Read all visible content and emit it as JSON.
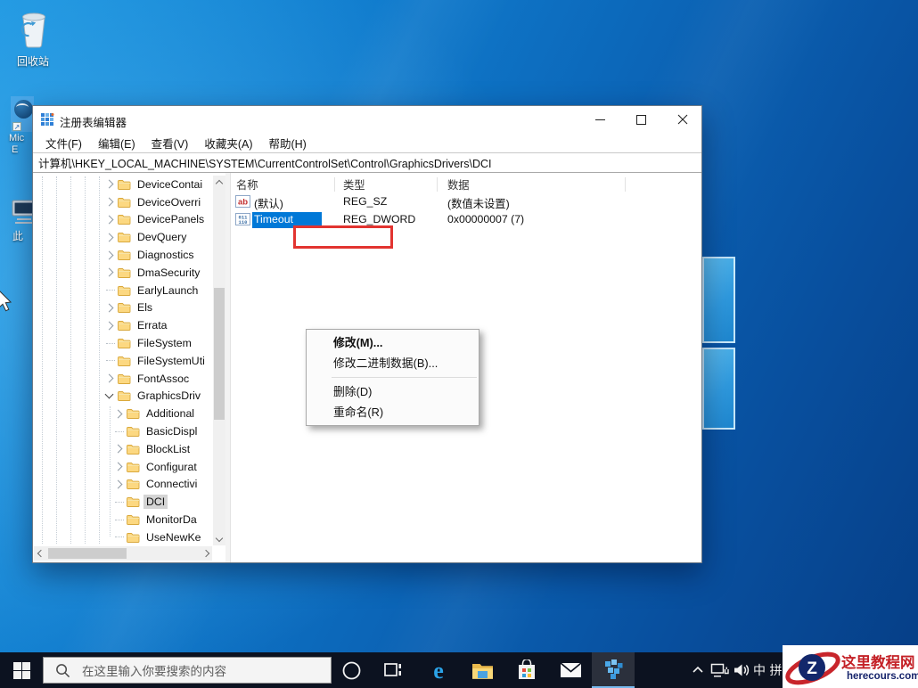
{
  "colors": {
    "accent": "#0078d7",
    "selection_blue": "#0078d7",
    "tree_selection_gray": "#d4d4d4",
    "annotation_red": "#e23430",
    "taskbar_bg": "#0c1220",
    "wallpaper_base": "#0b62b4",
    "watermark_red": "#c42127",
    "watermark_navy": "#16246b",
    "folder_yellow": "#fcd881"
  },
  "desktop": {
    "icons": [
      {
        "key": "recycle-bin",
        "label": "回收站"
      },
      {
        "key": "microsoft-edge",
        "label_line1": "Mic",
        "label_line2": "E"
      },
      {
        "key": "this-pc",
        "label": "此"
      }
    ]
  },
  "window": {
    "title": "注册表编辑器",
    "controls": {
      "minimize": "minimize",
      "maximize": "maximize",
      "close": "close"
    },
    "menu_items": [
      {
        "key": "file",
        "label": "文件(F)"
      },
      {
        "key": "edit",
        "label": "编辑(E)"
      },
      {
        "key": "view",
        "label": "查看(V)"
      },
      {
        "key": "favorites",
        "label": "收藏夹(A)"
      },
      {
        "key": "help",
        "label": "帮助(H)"
      }
    ],
    "address": "计算机\\HKEY_LOCAL_MACHINE\\SYSTEM\\CurrentControlSet\\Control\\GraphicsDrivers\\DCI",
    "tree": {
      "items": [
        {
          "label": "DeviceContai",
          "level": 0,
          "expand": "collapsed",
          "selected": false
        },
        {
          "label": "DeviceOverri",
          "level": 0,
          "expand": "collapsed",
          "selected": false
        },
        {
          "label": "DevicePanels",
          "level": 0,
          "expand": "collapsed",
          "selected": false
        },
        {
          "label": "DevQuery",
          "level": 0,
          "expand": "collapsed",
          "selected": false
        },
        {
          "label": "Diagnostics",
          "level": 0,
          "expand": "collapsed",
          "selected": false
        },
        {
          "label": "DmaSecurity",
          "level": 0,
          "expand": "collapsed",
          "selected": false
        },
        {
          "label": "EarlyLaunch",
          "level": 0,
          "expand": "none",
          "selected": false
        },
        {
          "label": "Els",
          "level": 0,
          "expand": "collapsed",
          "selected": false
        },
        {
          "label": "Errata",
          "level": 0,
          "expand": "collapsed",
          "selected": false
        },
        {
          "label": "FileSystem",
          "level": 0,
          "expand": "none",
          "selected": false
        },
        {
          "label": "FileSystemUti",
          "level": 0,
          "expand": "none",
          "selected": false
        },
        {
          "label": "FontAssoc",
          "level": 0,
          "expand": "collapsed",
          "selected": false
        },
        {
          "label": "GraphicsDriv",
          "level": 0,
          "expand": "expanded",
          "selected": false
        },
        {
          "label": "Additional",
          "level": 1,
          "expand": "collapsed",
          "selected": false
        },
        {
          "label": "BasicDispl",
          "level": 1,
          "expand": "none",
          "selected": false
        },
        {
          "label": "BlockList",
          "level": 1,
          "expand": "collapsed",
          "selected": false
        },
        {
          "label": "Configurat",
          "level": 1,
          "expand": "collapsed",
          "selected": false
        },
        {
          "label": "Connectivi",
          "level": 1,
          "expand": "collapsed",
          "selected": false
        },
        {
          "label": "DCI",
          "level": 1,
          "expand": "none",
          "selected": true
        },
        {
          "label": "MonitorDa",
          "level": 1,
          "expand": "none",
          "selected": false
        },
        {
          "label": "UseNewKe",
          "level": 1,
          "expand": "none",
          "selected": false
        }
      ]
    },
    "values": {
      "columns": [
        "名称",
        "类型",
        "数据"
      ],
      "rows": [
        {
          "icon": "string-icon",
          "name": "(默认)",
          "type": "REG_SZ",
          "data": "(数值未设置)",
          "selected": false
        },
        {
          "icon": "dword-icon",
          "name": "Timeout",
          "type": "REG_DWORD",
          "data": "0x00000007 (7)",
          "selected": true
        }
      ]
    },
    "context_menu": {
      "items": [
        {
          "key": "modify",
          "label": "修改(M)...",
          "bold": true,
          "annotated": true
        },
        {
          "key": "modify-binary",
          "label": "修改二进制数据(B)..."
        },
        {
          "separator": true
        },
        {
          "key": "delete",
          "label": "删除(D)"
        },
        {
          "key": "rename",
          "label": "重命名(R)"
        }
      ]
    }
  },
  "taskbar": {
    "search_placeholder": "在这里输入你要搜索的内容",
    "apps": [
      {
        "key": "cortana"
      },
      {
        "key": "task-view"
      },
      {
        "key": "edge"
      },
      {
        "key": "file-explorer"
      },
      {
        "key": "store"
      },
      {
        "key": "mail"
      },
      {
        "key": "regedit",
        "active": true
      }
    ],
    "tray": {
      "ime": "中",
      "ime_partial": "拼"
    }
  },
  "watermark": {
    "logo_letter": "Z",
    "line1": "这里教程网",
    "line2": "herecours.com"
  }
}
